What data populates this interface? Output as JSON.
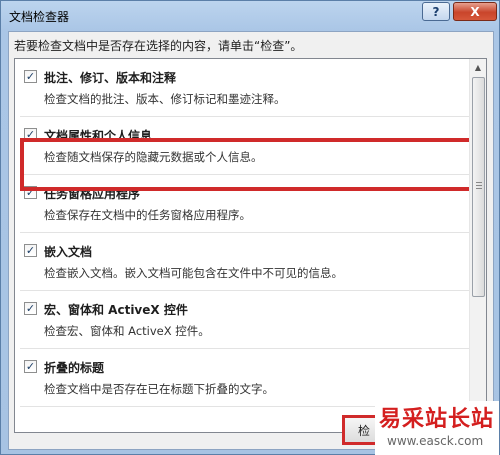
{
  "window": {
    "title": "文档检查器"
  },
  "titlebar_buttons": {
    "help": "?",
    "close": "X"
  },
  "instruction": "若要检查文档中是否存在选择的内容，请单击“检查”。",
  "items": [
    {
      "label": "批注、修订、版本和注释",
      "desc": "检查文档的批注、版本、修订标记和墨迹注释。",
      "checked": true
    },
    {
      "label": "文档属性和个人信息",
      "desc": "检查随文档保存的隐藏元数据或个人信息。",
      "checked": true
    },
    {
      "label": "任务窗格应用程序",
      "desc": "检查保存在文档中的任务窗格应用程序。",
      "checked": true
    },
    {
      "label": "嵌入文档",
      "desc": "检查嵌入文档。嵌入文档可能包含在文件中不可见的信息。",
      "checked": true
    },
    {
      "label": "宏、窗体和 ActiveX 控件",
      "desc": "检查宏、窗体和 ActiveX 控件。",
      "checked": true
    },
    {
      "label": "折叠的标题",
      "desc": "检查文档中是否存在已在标题下折叠的文字。",
      "checked": true
    }
  ],
  "inspect_button": "检",
  "watermark": {
    "brand": "易采站长站",
    "url": "www.easck.com"
  },
  "colors": {
    "highlight": "#d02a2a",
    "brand": "#d41f1f"
  }
}
